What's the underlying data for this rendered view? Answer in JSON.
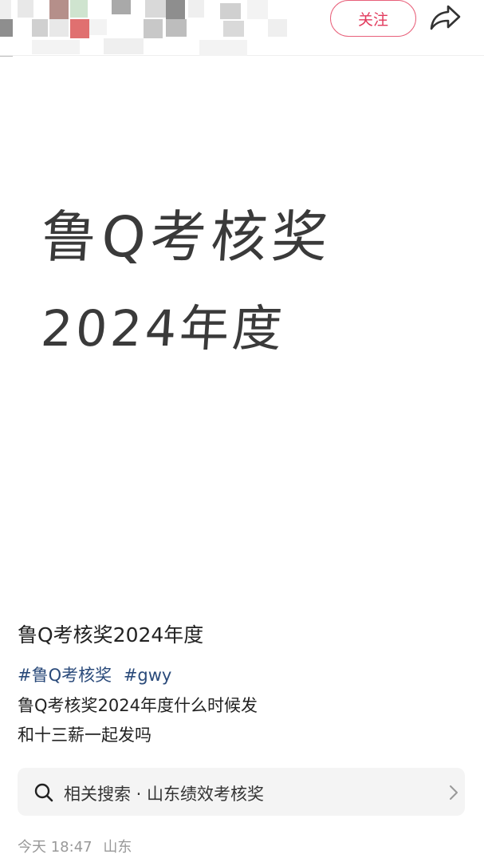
{
  "header": {
    "follow_label": "关注",
    "share_icon": "share-icon",
    "mosaic_colors": [
      "#d9d9d9",
      "#bdbdbd",
      "#b58f8a",
      "#cfe4cf",
      "#8e8e8e",
      "#e07070",
      "#c8c8c8",
      "#efefef",
      "#a9a9a9",
      "#d0d0d0",
      "#e8e8e8",
      "#f3f3f3"
    ]
  },
  "image": {
    "line1": "鲁Q考核奖",
    "line2": "2024年度"
  },
  "post": {
    "title": "鲁Q考核奖2024年度",
    "hashtags": [
      "#鲁Q考核奖",
      "#gwy"
    ],
    "body_line1": "鲁Q考核奖2024年度什么时候发",
    "body_line2": "和十三薪一起发吗"
  },
  "related_search": {
    "label": "相关搜索 · 山东绩效考核奖",
    "icon": "search-icon",
    "chevron": "chevron-right-icon"
  },
  "meta": {
    "time": "今天 18:47",
    "location": "山东"
  }
}
